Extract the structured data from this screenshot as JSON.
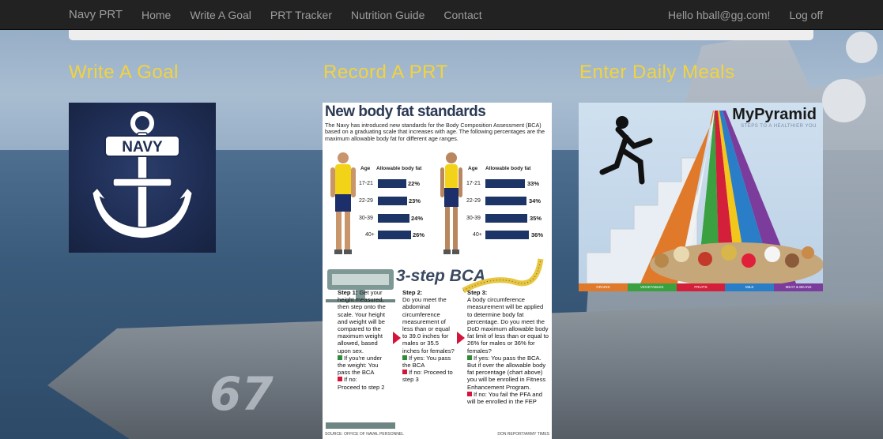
{
  "navbar": {
    "brand": "Navy PRT",
    "links": [
      "Home",
      "Write A Goal",
      "PRT Tracker",
      "Nutrition Guide",
      "Contact"
    ],
    "greeting": "Hello hball@gg.com!",
    "logoff": "Log off"
  },
  "background": {
    "hull_number": "67"
  },
  "sections": {
    "goal_title": "Write A Goal",
    "prt_title": "Record A PRT",
    "meals_title": "Enter Daily Meals"
  },
  "navy_image": {
    "text": "NAVY"
  },
  "bodyfat": {
    "title": "New body fat standards",
    "intro": "The Navy has introduced new standards for the Body Composition Assessment (BCA) based on a graduating scale that increases with age. The following percentages are the maximum allowable body fat for different age ranges.",
    "col_age": "Age",
    "col_allow": "Allowable body fat",
    "male": [
      {
        "age": "17-21",
        "pct": "22%",
        "value": 22
      },
      {
        "age": "22-29",
        "pct": "23%",
        "value": 23
      },
      {
        "age": "30-39",
        "pct": "24%",
        "value": 24
      },
      {
        "age": "40+",
        "pct": "26%",
        "value": 26
      }
    ],
    "female": [
      {
        "age": "17-21",
        "pct": "33%",
        "value": 33
      },
      {
        "age": "22-29",
        "pct": "34%",
        "value": 34
      },
      {
        "age": "30-39",
        "pct": "35%",
        "value": 35
      },
      {
        "age": "40+",
        "pct": "36%",
        "value": 36
      }
    ],
    "bca_title": "3-step BCA",
    "step1_head": "Step 1:",
    "step1": "Get your height measured, then step onto the scale. Your height and weight will be compared to the maximum weight allowed, based upon sex.",
    "step1_yes": "If you're under the weight: You pass the BCA",
    "step1_no_label": "If no:",
    "step1_no": "Proceed to step 2",
    "step2_head": "Step 2:",
    "step2": "Do you meet the abdominal circumference measurement of less than or equal to 39.0 inches for males or 35.5 inches for females?",
    "step2_yes": "If yes: You pass the BCA",
    "step2_no": "If no: Proceed to step 3",
    "step3_head": "Step 3:",
    "step3": "A body circumference measurement will be applied to determine body fat percentage. Do you meet the DoD maximum allowable body fat limit of less than or equal to 26% for males or 36% for females?",
    "step3_yes": "If yes: You pass the BCA. But if over the allowable body fat percentage (chart above) you will be enrolled in Fitness Enhancement Program.",
    "step3_no": "If no: You fail the PFA and will be enrolled in the FEP",
    "credit_left": "SOURCE: OFFICE OF NAVAL PERSONNEL",
    "credit_right": "DON REPORT/ARMY TIMES"
  },
  "pyramid": {
    "logo": "MyPyramid",
    "subtitle": "STEPS TO A HEALTHIER YOU",
    "groups": [
      {
        "label": "GRAINS",
        "color": "#e07a2a"
      },
      {
        "label": "VEGETABLES",
        "color": "#3aa040"
      },
      {
        "label": "FRUITS",
        "color": "#d41f3a"
      },
      {
        "label": "MILK",
        "color": "#2a7ec8"
      },
      {
        "label": "MEAT & BEANS",
        "color": "#7b3c9c"
      }
    ]
  }
}
